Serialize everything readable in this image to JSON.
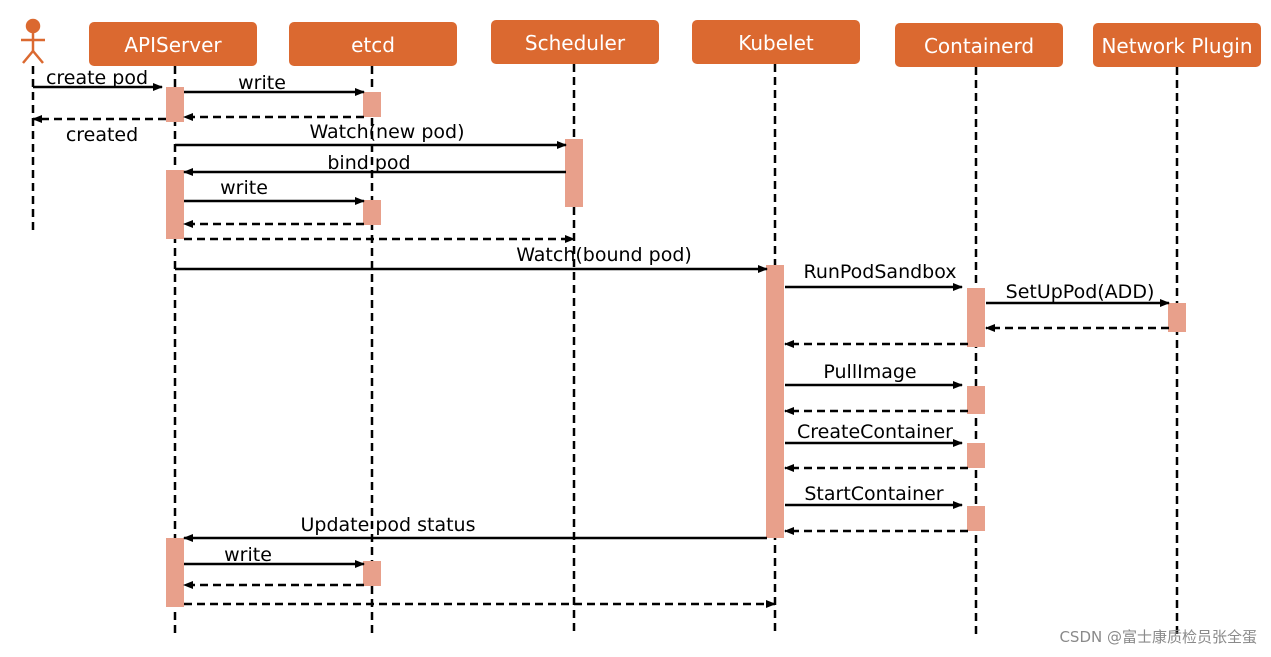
{
  "colors": {
    "participant": "#DB6930",
    "activation": "#E8A08B",
    "line": "#000000",
    "actor": "#DB6930"
  },
  "actor": {
    "icon": "stick-figure-actor-icon"
  },
  "participants": [
    "APIServer",
    "etcd",
    "Scheduler",
    "Kubelet",
    "Containerd",
    "Network Plugin"
  ],
  "messages": [
    {
      "from": "actor",
      "to": "APIServer",
      "label": "create pod",
      "style": "solid"
    },
    {
      "from": "APIServer",
      "to": "etcd",
      "label": "write",
      "style": "solid"
    },
    {
      "from": "etcd",
      "to": "APIServer",
      "label": "",
      "style": "dashed"
    },
    {
      "from": "APIServer",
      "to": "actor",
      "label": "created",
      "style": "dashed"
    },
    {
      "from": "APIServer",
      "to": "Scheduler",
      "label": "Watch(new pod)",
      "style": "solid"
    },
    {
      "from": "Scheduler",
      "to": "APIServer",
      "label": "bind pod",
      "style": "solid"
    },
    {
      "from": "APIServer",
      "to": "etcd",
      "label": "write",
      "style": "solid"
    },
    {
      "from": "etcd",
      "to": "APIServer",
      "label": "",
      "style": "dashed"
    },
    {
      "from": "APIServer",
      "to": "Scheduler",
      "label": "",
      "style": "dashed"
    },
    {
      "from": "APIServer",
      "to": "Kubelet",
      "label": "Watch(bound pod)",
      "style": "solid"
    },
    {
      "from": "Kubelet",
      "to": "Containerd",
      "label": "RunPodSandbox",
      "style": "solid"
    },
    {
      "from": "Containerd",
      "to": "Network Plugin",
      "label": "SetUpPod(ADD)",
      "style": "solid"
    },
    {
      "from": "Network Plugin",
      "to": "Containerd",
      "label": "",
      "style": "dashed"
    },
    {
      "from": "Containerd",
      "to": "Kubelet",
      "label": "",
      "style": "dashed"
    },
    {
      "from": "Kubelet",
      "to": "Containerd",
      "label": "PullImage",
      "style": "solid"
    },
    {
      "from": "Containerd",
      "to": "Kubelet",
      "label": "",
      "style": "dashed"
    },
    {
      "from": "Kubelet",
      "to": "Containerd",
      "label": "CreateContainer",
      "style": "solid"
    },
    {
      "from": "Containerd",
      "to": "Kubelet",
      "label": "",
      "style": "dashed"
    },
    {
      "from": "Kubelet",
      "to": "Containerd",
      "label": "StartContainer",
      "style": "solid"
    },
    {
      "from": "Containerd",
      "to": "Kubelet",
      "label": "",
      "style": "dashed"
    },
    {
      "from": "Kubelet",
      "to": "APIServer",
      "label": "Update pod status",
      "style": "solid"
    },
    {
      "from": "APIServer",
      "to": "etcd",
      "label": "write",
      "style": "solid"
    },
    {
      "from": "etcd",
      "to": "APIServer",
      "label": "",
      "style": "dashed"
    },
    {
      "from": "APIServer",
      "to": "Kubelet",
      "label": "",
      "style": "dashed"
    }
  ],
  "watermark": "CSDN @富士康质检员张全蛋"
}
